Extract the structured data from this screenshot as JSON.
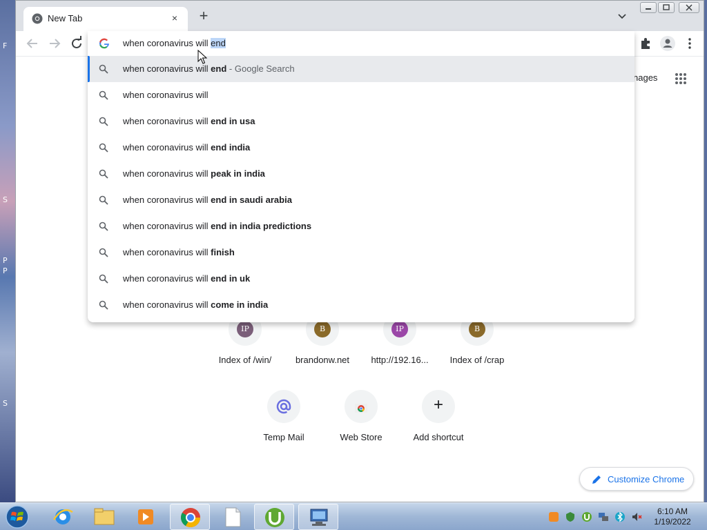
{
  "desktop": {
    "left_labels": [
      "F",
      "S",
      "P",
      "P",
      "S"
    ]
  },
  "tab": {
    "title": "New Tab",
    "close_glyph": "×"
  },
  "newtab_glyph": "+",
  "omnibox": {
    "typed": "when coronavirus will ",
    "selected": "end"
  },
  "suggestions": [
    {
      "prefix": "when coronavirus will ",
      "bold": "end",
      "desc": " - Google Search",
      "active": true
    },
    {
      "prefix": "when coronavirus will",
      "bold": "",
      "desc": ""
    },
    {
      "prefix": "when coronavirus will ",
      "bold": "end in usa",
      "desc": ""
    },
    {
      "prefix": "when coronavirus will ",
      "bold": "end india",
      "desc": ""
    },
    {
      "prefix": "when coronavirus will ",
      "bold": "peak in india",
      "desc": ""
    },
    {
      "prefix": "when coronavirus will ",
      "bold": "end in saudi arabia",
      "desc": ""
    },
    {
      "prefix": "when coronavirus will ",
      "bold": "end in india predictions",
      "desc": ""
    },
    {
      "prefix": "when coronavirus will ",
      "bold": "finish",
      "desc": ""
    },
    {
      "prefix": "when coronavirus will ",
      "bold": "end in uk",
      "desc": ""
    },
    {
      "prefix": "when coronavirus will ",
      "bold": "come in india",
      "desc": ""
    }
  ],
  "page": {
    "images_link": "nages",
    "shortcuts_row1": [
      {
        "label": "Index of /win/",
        "badge": "IP",
        "color": "#7b5f7a"
      },
      {
        "label": "brandonw.net",
        "badge": "B",
        "color": "#8a6a2a"
      },
      {
        "label": "http://192.16...",
        "badge": "IP",
        "color": "#9b47a8"
      },
      {
        "label": "Index of /crap",
        "badge": "B",
        "color": "#8a6a2a"
      }
    ],
    "shortcuts_row2": [
      {
        "label": "Temp Mail",
        "icon": "at-icon"
      },
      {
        "label": "Web Store",
        "icon": "web-store-icon"
      },
      {
        "label": "Add shortcut",
        "icon": "plus-icon",
        "glyph": "+"
      }
    ],
    "customize_label": "Customize Chrome"
  },
  "taskbar": {
    "clock_time": "6:10 AM",
    "clock_date": "1/19/2022",
    "apps": [
      "internet-explorer",
      "file-explorer",
      "media-player",
      "chrome",
      "document",
      "utorrent",
      "network-computer"
    ]
  },
  "colors": {
    "accent": "#1a73e8",
    "suggestion_highlight": "#e8eaed",
    "selection": "#bcd6f8"
  }
}
